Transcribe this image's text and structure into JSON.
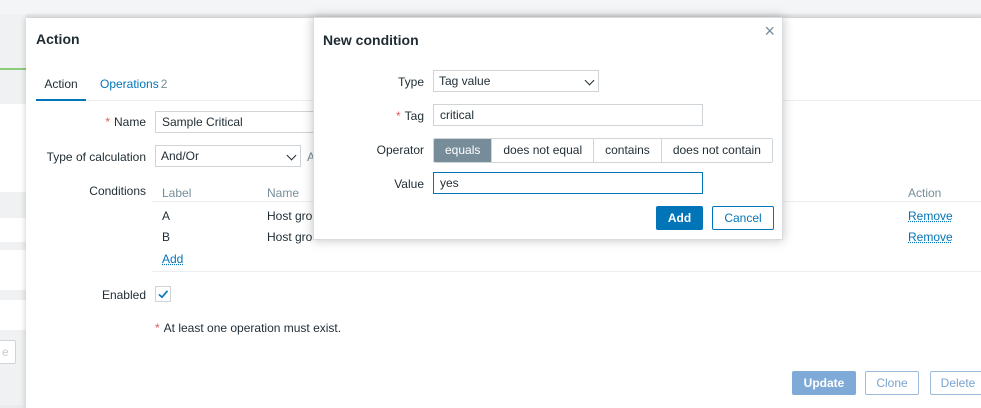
{
  "action_dialog": {
    "title": "Action",
    "tabs": [
      {
        "label": "Action"
      },
      {
        "label": "Operations",
        "count": "2"
      }
    ],
    "name_label": "Name",
    "name_value": "Sample Critical",
    "calc_label": "Type of calculation",
    "calc_value": "And/Or",
    "calc_expression_cut": "A",
    "conditions_label": "Conditions",
    "conditions": {
      "headers": {
        "label": "Label",
        "name": "Name",
        "action": "Action"
      },
      "rows": [
        {
          "label": "A",
          "name": "Host gro",
          "action": "Remove"
        },
        {
          "label": "B",
          "name": "Host gro",
          "action": "Remove"
        }
      ],
      "add_label": "Add"
    },
    "enabled_label": "Enabled",
    "enabled_checked": true,
    "note": "At least one operation must exist.",
    "buttons": {
      "update": "Update",
      "clone": "Clone",
      "delete": "Delete"
    }
  },
  "background": {
    "cut_button": "e"
  },
  "modal": {
    "title": "New condition",
    "close_glyph": "×",
    "type_label": "Type",
    "type_value": "Tag value",
    "tag_label": "Tag",
    "tag_value": "critical",
    "operator_label": "Operator",
    "operators": [
      "equals",
      "does not equal",
      "contains",
      "does not contain"
    ],
    "operator_selected": "equals",
    "value_label": "Value",
    "value_value": "yes",
    "add_label": "Add",
    "cancel_label": "Cancel"
  },
  "colors": {
    "accent": "#0275b8",
    "required": "#e45959",
    "segment_active": "#768d99"
  }
}
